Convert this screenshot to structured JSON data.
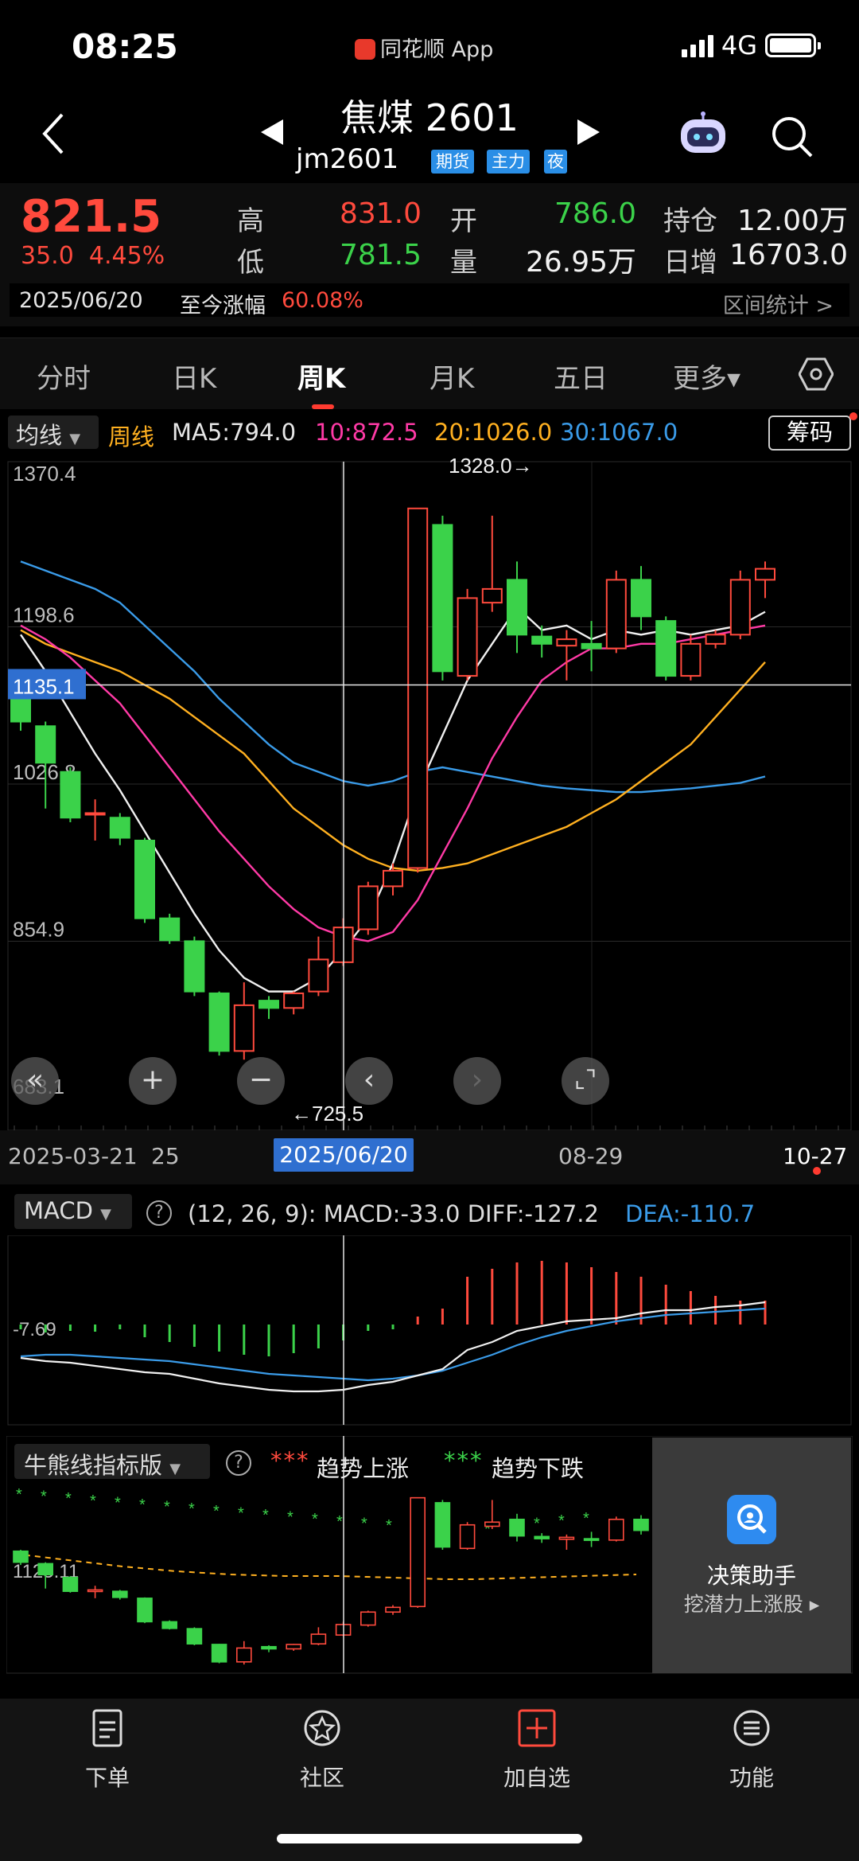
{
  "status_bar": {
    "time": "08:25",
    "app_name": "同花顺 App",
    "network": "4G"
  },
  "header": {
    "title": "焦煤 2601",
    "code": "jm2601",
    "tags": [
      "期货",
      "主力",
      "夜"
    ]
  },
  "quote": {
    "price": "821.5",
    "change": "35.0",
    "change_pct": "4.45%",
    "high_label": "高",
    "high": "831.0",
    "low_label": "低",
    "low": "781.5",
    "open_label": "开",
    "open": "786.0",
    "volume_label": "量",
    "volume": "26.95万",
    "oi_label": "持仓",
    "oi": "12.00万",
    "daily_inc_label": "日增",
    "daily_inc": "16703.0",
    "date": "2025/06/20",
    "since_label": "至今涨幅",
    "since_value": "60.08%",
    "range_stat": "区间统计 >"
  },
  "tabs": [
    {
      "label": "分时"
    },
    {
      "label": "日K"
    },
    {
      "label": "周K",
      "active": true
    },
    {
      "label": "月K"
    },
    {
      "label": "五日"
    },
    {
      "label": "更多▾"
    }
  ],
  "ma_legend": {
    "selector": "均线",
    "period": "周线",
    "ma5": "MA5:794.0",
    "ma10": "10:872.5",
    "ma20": "20:1026.0",
    "ma30": "30:1067.0",
    "chip_button": "筹码"
  },
  "colors": {
    "up": "#ff4a3d",
    "down": "#3bd24a",
    "ma5": "#f0f0f0",
    "ma10": "#ff3aa6",
    "ma20": "#ffb020",
    "ma30": "#3a9be8",
    "accent": "#2f6fd0"
  },
  "chart_data": {
    "type": "candlestick",
    "y_ticks": [
      "1370.4",
      "1198.6",
      "1026.8",
      "854.9",
      "683.1"
    ],
    "ylim": [
      683.1,
      1370.4
    ],
    "crosshair_value": "1135.1",
    "crosshair_date": "2025/06/20",
    "max_label": "1328.0→",
    "min_label": "←725.5",
    "x_labels": [
      "2025-03-21",
      "25",
      "08-29",
      "10-27"
    ],
    "candles": [
      {
        "o": 1135,
        "h": 1140,
        "l": 1085,
        "c": 1095
      },
      {
        "o": 1090,
        "h": 1095,
        "l": 1000,
        "c": 1050
      },
      {
        "o": 1040,
        "h": 1045,
        "l": 985,
        "c": 990
      },
      {
        "o": 995,
        "h": 1010,
        "l": 965,
        "c": 995
      },
      {
        "o": 990,
        "h": 995,
        "l": 960,
        "c": 968
      },
      {
        "o": 965,
        "h": 968,
        "l": 875,
        "c": 880
      },
      {
        "o": 880,
        "h": 885,
        "l": 852,
        "c": 856
      },
      {
        "o": 855,
        "h": 860,
        "l": 795,
        "c": 800
      },
      {
        "o": 798,
        "h": 800,
        "l": 730,
        "c": 735
      },
      {
        "o": 735,
        "h": 810,
        "l": 725.5,
        "c": 785
      },
      {
        "o": 790,
        "h": 795,
        "l": 770,
        "c": 782
      },
      {
        "o": 782,
        "h": 800,
        "l": 775,
        "c": 798
      },
      {
        "o": 800,
        "h": 860,
        "l": 795,
        "c": 835
      },
      {
        "o": 832,
        "h": 880,
        "l": 828,
        "c": 870
      },
      {
        "o": 868,
        "h": 920,
        "l": 862,
        "c": 915
      },
      {
        "o": 915,
        "h": 940,
        "l": 905,
        "c": 932
      },
      {
        "o": 935,
        "h": 1328,
        "l": 930,
        "c": 1328
      },
      {
        "o": 1310,
        "h": 1320,
        "l": 1140,
        "c": 1150
      },
      {
        "o": 1145,
        "h": 1240,
        "l": 1140,
        "c": 1230
      },
      {
        "o": 1225,
        "h": 1320,
        "l": 1215,
        "c": 1240
      },
      {
        "o": 1250,
        "h": 1270,
        "l": 1170,
        "c": 1190
      },
      {
        "o": 1188,
        "h": 1200,
        "l": 1165,
        "c": 1180
      },
      {
        "o": 1178,
        "h": 1195,
        "l": 1140,
        "c": 1185
      },
      {
        "o": 1180,
        "h": 1205,
        "l": 1150,
        "c": 1175
      },
      {
        "o": 1175,
        "h": 1260,
        "l": 1170,
        "c": 1250
      },
      {
        "o": 1250,
        "h": 1265,
        "l": 1195,
        "c": 1210
      },
      {
        "o": 1205,
        "h": 1210,
        "l": 1140,
        "c": 1145
      },
      {
        "o": 1145,
        "h": 1190,
        "l": 1140,
        "c": 1180
      },
      {
        "o": 1180,
        "h": 1195,
        "l": 1175,
        "c": 1190
      },
      {
        "o": 1190,
        "h": 1260,
        "l": 1185,
        "c": 1250
      },
      {
        "o": 1250,
        "h": 1270,
        "l": 1230,
        "c": 1262
      }
    ],
    "ma5": [
      1190,
      1150,
      1105,
      1060,
      1020,
      975,
      930,
      885,
      845,
      815,
      800,
      800,
      815,
      845,
      880,
      940,
      1020,
      1080,
      1140,
      1180,
      1220,
      1195,
      1200,
      1185,
      1195,
      1190,
      1195,
      1190,
      1195,
      1200,
      1215
    ],
    "ma10": [
      1200,
      1185,
      1165,
      1140,
      1115,
      1080,
      1045,
      1010,
      975,
      945,
      915,
      890,
      870,
      860,
      855,
      865,
      900,
      950,
      1000,
      1055,
      1100,
      1140,
      1160,
      1175,
      1175,
      1180,
      1180,
      1185,
      1190,
      1195,
      1200
    ],
    "ma20": [
      1195,
      1180,
      1170,
      1160,
      1150,
      1135,
      1120,
      1100,
      1080,
      1060,
      1030,
      1000,
      980,
      960,
      945,
      935,
      932,
      935,
      940,
      950,
      960,
      970,
      980,
      995,
      1010,
      1030,
      1050,
      1070,
      1100,
      1130,
      1160
    ],
    "ma30": [
      1270,
      1260,
      1250,
      1240,
      1225,
      1200,
      1175,
      1150,
      1120,
      1095,
      1070,
      1050,
      1040,
      1030,
      1025,
      1030,
      1040,
      1045,
      1040,
      1035,
      1030,
      1025,
      1022,
      1020,
      1018,
      1018,
      1020,
      1022,
      1025,
      1028,
      1035
    ]
  },
  "macd": {
    "selector": "MACD",
    "params": "(12, 26, 9):  MACD:-33.0  DIFF:-127.2",
    "dea": "DEA:-110.7",
    "y_label": "-7.69"
  },
  "bull_bear": {
    "selector": "牛熊线指标版",
    "up_dots": "***",
    "up_label": "趋势上涨",
    "down_dots": "***",
    "down_label": "趋势下跌",
    "y_label": "1125.11"
  },
  "assistant": {
    "title": "决策助手",
    "subtitle": "挖潜力上涨股 ▸"
  },
  "bottom_nav": [
    {
      "label": "下单",
      "icon": "order-icon"
    },
    {
      "label": "社区",
      "icon": "community-icon"
    },
    {
      "label": "加自选",
      "icon": "add-watchlist-icon"
    },
    {
      "label": "功能",
      "icon": "menu-icon"
    }
  ]
}
